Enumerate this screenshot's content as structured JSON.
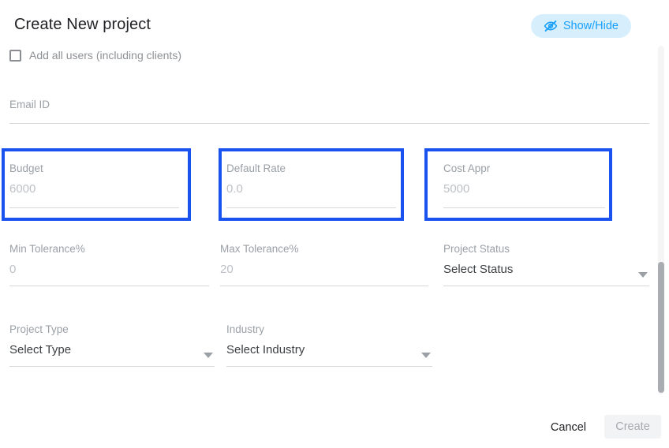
{
  "dialog": {
    "title": "Create New project"
  },
  "header": {
    "show_hide_label": "Show/Hide",
    "show_hide_icon": "eye-off-icon",
    "accent_color": "#18a0fb",
    "accent_bg": "#d7effd"
  },
  "checkbox": {
    "label": "Add all users (including clients)",
    "checked": false
  },
  "fields": {
    "email": {
      "label": "Email ID",
      "value": ""
    },
    "budget": {
      "label": "Budget",
      "value": "6000"
    },
    "default_rate": {
      "label": "Default Rate",
      "value": "0.0"
    },
    "cost_appr": {
      "label": "Cost Appr",
      "value": "5000"
    },
    "min_tolerance": {
      "label": "Min Tolerance%",
      "value": "0"
    },
    "max_tolerance": {
      "label": "Max Tolerance%",
      "value": "20"
    },
    "project_status": {
      "label": "Project Status",
      "value": "Select Status"
    },
    "project_type": {
      "label": "Project Type",
      "value": "Select Type"
    },
    "industry": {
      "label": "Industry",
      "value": "Select Industry"
    }
  },
  "highlights": {
    "color": "#1a52f0",
    "targets": [
      "budget",
      "default_rate",
      "cost_appr"
    ]
  },
  "footer": {
    "cancel_label": "Cancel",
    "create_label": "Create"
  }
}
